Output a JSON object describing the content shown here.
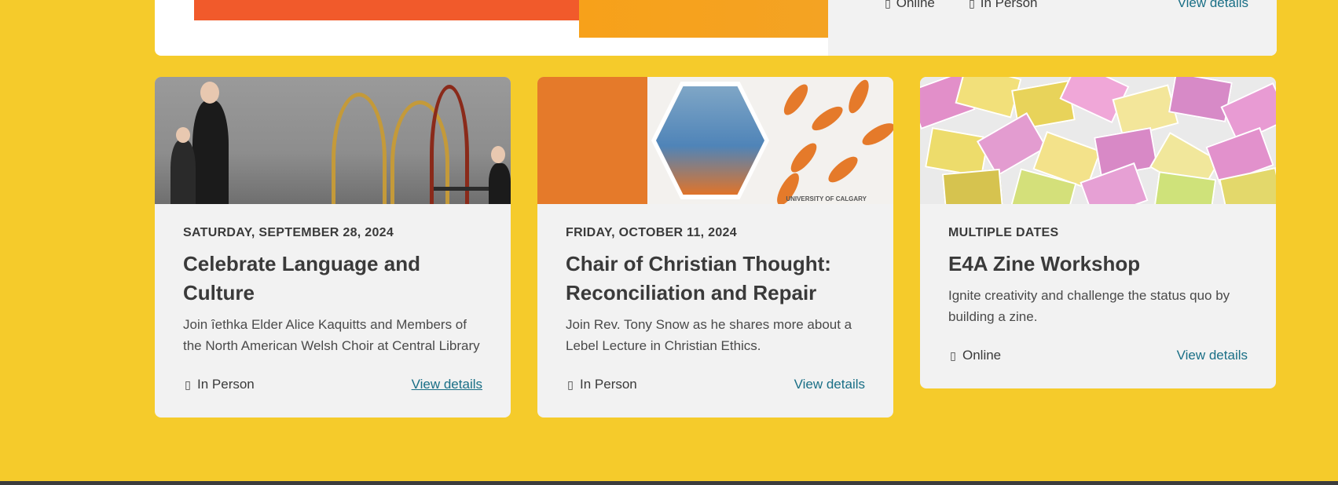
{
  "top_card": {
    "mode_online": "Online",
    "mode_in_person": "In Person",
    "link_label": "View details"
  },
  "events": [
    {
      "date": "SATURDAY, SEPTEMBER 28, 2024",
      "title": "Celebrate Language and Culture",
      "description": "Join ȋethka Elder Alice Kaquitts and Members of the North American Welsh Choir at Central Library",
      "mode": "In Person",
      "mode_icon": "location-icon",
      "link_label": "View details"
    },
    {
      "date": "FRIDAY, OCTOBER 11, 2024",
      "title": "Chair of Christian Thought: Reconciliation and Repair",
      "description": "Join Rev. Tony Snow as he shares more about a Lebel Lecture in Christian Ethics.",
      "mode": "In Person",
      "mode_icon": "location-icon",
      "link_label": "View details",
      "logo_text": "UNIVERSITY OF CALGARY"
    },
    {
      "date": "MULTIPLE DATES",
      "title": "E4A Zine Workshop",
      "description": "Ignite creativity and challenge the status quo by building a zine.",
      "mode": "Online",
      "mode_icon": "laptop-icon",
      "link_label": "View details"
    }
  ],
  "colors": {
    "page_bg": "#f5cb2b",
    "card_bg": "#f2f2f2",
    "link": "#1a6f86",
    "text": "#3a3a3a",
    "accent_orange": "#e57a2a"
  }
}
